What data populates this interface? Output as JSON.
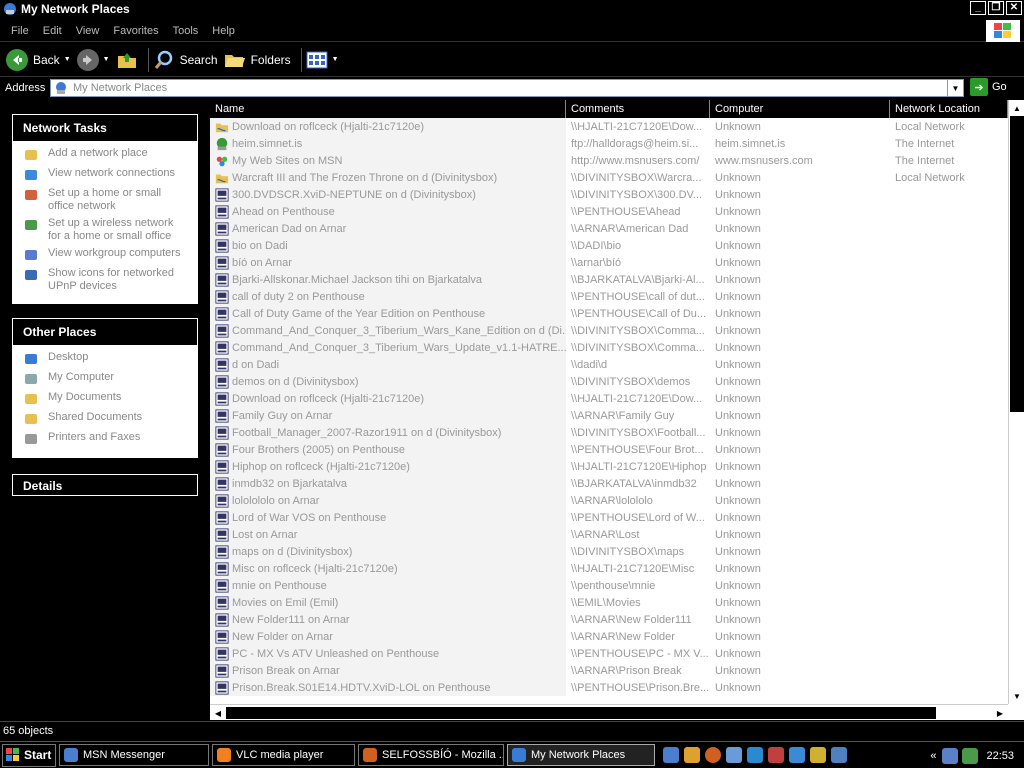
{
  "window": {
    "title": "My Network Places"
  },
  "menu": [
    "File",
    "Edit",
    "View",
    "Favorites",
    "Tools",
    "Help"
  ],
  "toolbar": {
    "back": "Back",
    "search": "Search",
    "folders": "Folders"
  },
  "address": {
    "label": "Address",
    "value": "My Network Places",
    "go": "Go"
  },
  "network_tasks": {
    "title": "Network Tasks",
    "items": [
      {
        "label": "Add a network place",
        "icon": "add-network-place-icon"
      },
      {
        "label": "View network connections",
        "icon": "network-connections-icon"
      },
      {
        "label": "Set up a home or small office network",
        "icon": "home-network-icon"
      },
      {
        "label": "Set up a wireless network for a home or small office",
        "icon": "wireless-network-icon"
      },
      {
        "label": "View workgroup computers",
        "icon": "workgroup-icon"
      },
      {
        "label": "Show icons for networked UPnP devices",
        "icon": "upnp-icon"
      }
    ]
  },
  "other_places": {
    "title": "Other Places",
    "items": [
      {
        "label": "Desktop",
        "icon": "desktop-icon"
      },
      {
        "label": "My Computer",
        "icon": "my-computer-icon"
      },
      {
        "label": "My Documents",
        "icon": "my-documents-icon"
      },
      {
        "label": "Shared Documents",
        "icon": "folder-icon"
      },
      {
        "label": "Printers and Faxes",
        "icon": "printer-icon"
      }
    ]
  },
  "details": {
    "title": "Details"
  },
  "columns": [
    "Name",
    "Comments",
    "Computer",
    "Network Location"
  ],
  "rows": [
    {
      "name": "Download on roflceck (Hjalti-21c7120e)",
      "comments": "\\\\HJALTI-21C7120E\\Dow...",
      "computer": "Unknown",
      "location": "Local Network",
      "icon": "share"
    },
    {
      "name": "heim.simnet.is",
      "comments": "ftp://halldorags@heim.si...",
      "computer": "heim.simnet.is",
      "location": "The Internet",
      "icon": "ftp"
    },
    {
      "name": "My Web Sites on MSN",
      "comments": "http://www.msnusers.com/",
      "computer": "www.msnusers.com",
      "location": "The Internet",
      "icon": "msn"
    },
    {
      "name": "Warcraft III and The Frozen Throne on d (Divinitysbox)",
      "comments": "\\\\DIVINITYSBOX\\Warcra...",
      "computer": "Unknown",
      "location": "Local Network",
      "icon": "share"
    },
    {
      "name": "300.DVDSCR.XviD-NEPTUNE on d (Divinitysbox)",
      "comments": "\\\\DIVINITYSBOX\\300.DV...",
      "computer": "Unknown",
      "location": "",
      "icon": "net"
    },
    {
      "name": "Ahead on Penthouse",
      "comments": "\\\\PENTHOUSE\\Ahead",
      "computer": "Unknown",
      "location": "",
      "icon": "net"
    },
    {
      "name": "American Dad on Arnar",
      "comments": "\\\\ARNAR\\American Dad",
      "computer": "Unknown",
      "location": "",
      "icon": "net"
    },
    {
      "name": "bio on Dadi",
      "comments": "\\\\DADI\\bio",
      "computer": "Unknown",
      "location": "",
      "icon": "net"
    },
    {
      "name": "bíó on Arnar",
      "comments": "\\\\arnar\\bíó",
      "computer": "Unknown",
      "location": "",
      "icon": "net"
    },
    {
      "name": "Bjarki-Allskonar.Michael Jackson tihi on Bjarkatalva",
      "comments": "\\\\BJARKATALVA\\Bjarki-Al...",
      "computer": "Unknown",
      "location": "",
      "icon": "net"
    },
    {
      "name": "call of duty 2 on Penthouse",
      "comments": "\\\\PENTHOUSE\\call of dut...",
      "computer": "Unknown",
      "location": "",
      "icon": "net"
    },
    {
      "name": "Call of Duty Game of the Year Edition on Penthouse",
      "comments": "\\\\PENTHOUSE\\Call of Du...",
      "computer": "Unknown",
      "location": "",
      "icon": "net"
    },
    {
      "name": "Command_And_Conquer_3_Tiberium_Wars_Kane_Edition on d (Di...",
      "comments": "\\\\DIVINITYSBOX\\Comma...",
      "computer": "Unknown",
      "location": "",
      "icon": "net"
    },
    {
      "name": "Command_And_Conquer_3_Tiberium_Wars_Update_v1.1-HATRE...",
      "comments": "\\\\DIVINITYSBOX\\Comma...",
      "computer": "Unknown",
      "location": "",
      "icon": "net"
    },
    {
      "name": "d on Dadi",
      "comments": "\\\\dadi\\d",
      "computer": "Unknown",
      "location": "",
      "icon": "net"
    },
    {
      "name": "demos on d (Divinitysbox)",
      "comments": "\\\\DIVINITYSBOX\\demos",
      "computer": "Unknown",
      "location": "",
      "icon": "net"
    },
    {
      "name": "Download on roflceck (Hjalti-21c7120e)",
      "comments": "\\\\HJALTI-21C7120E\\Dow...",
      "computer": "Unknown",
      "location": "",
      "icon": "net"
    },
    {
      "name": "Family Guy on Arnar",
      "comments": "\\\\ARNAR\\Family Guy",
      "computer": "Unknown",
      "location": "",
      "icon": "net"
    },
    {
      "name": "Football_Manager_2007-Razor1911 on d (Divinitysbox)",
      "comments": "\\\\DIVINITYSBOX\\Football...",
      "computer": "Unknown",
      "location": "",
      "icon": "net"
    },
    {
      "name": "Four Brothers (2005) on Penthouse",
      "comments": "\\\\PENTHOUSE\\Four Brot...",
      "computer": "Unknown",
      "location": "",
      "icon": "net"
    },
    {
      "name": "Hiphop on roflceck (Hjalti-21c7120e)",
      "comments": "\\\\HJALTI-21C7120E\\Hiphop",
      "computer": "Unknown",
      "location": "",
      "icon": "net"
    },
    {
      "name": "inmdb32 on Bjarkatalva",
      "comments": "\\\\BJARKATALVA\\inmdb32",
      "computer": "Unknown",
      "location": "",
      "icon": "net"
    },
    {
      "name": "lololololo on Arnar",
      "comments": "\\\\ARNAR\\lolololo",
      "computer": "Unknown",
      "location": "",
      "icon": "net"
    },
    {
      "name": "Lord of War VOS on Penthouse",
      "comments": "\\\\PENTHOUSE\\Lord of W...",
      "computer": "Unknown",
      "location": "",
      "icon": "net"
    },
    {
      "name": "Lost on Arnar",
      "comments": "\\\\ARNAR\\Lost",
      "computer": "Unknown",
      "location": "",
      "icon": "net"
    },
    {
      "name": "maps on d (Divinitysbox)",
      "comments": "\\\\DIVINITYSBOX\\maps",
      "computer": "Unknown",
      "location": "",
      "icon": "net"
    },
    {
      "name": "Misc on roflceck (Hjalti-21c7120e)",
      "comments": "\\\\HJALTI-21C7120E\\Misc",
      "computer": "Unknown",
      "location": "",
      "icon": "net"
    },
    {
      "name": "mnie on Penthouse",
      "comments": "\\\\penthouse\\mnie",
      "computer": "Unknown",
      "location": "",
      "icon": "net"
    },
    {
      "name": "Movies on Emil (Emil)",
      "comments": "\\\\EMIL\\Movies",
      "computer": "Unknown",
      "location": "",
      "icon": "net"
    },
    {
      "name": "New Folder111 on Arnar",
      "comments": "\\\\ARNAR\\New Folder111",
      "computer": "Unknown",
      "location": "",
      "icon": "net"
    },
    {
      "name": "New Folder on Arnar",
      "comments": "\\\\ARNAR\\New Folder",
      "computer": "Unknown",
      "location": "",
      "icon": "net"
    },
    {
      "name": "PC - MX Vs ATV Unleashed on Penthouse",
      "comments": "\\\\PENTHOUSE\\PC - MX V...",
      "computer": "Unknown",
      "location": "",
      "icon": "net"
    },
    {
      "name": "Prison Break on Arnar",
      "comments": "\\\\ARNAR\\Prison Break",
      "computer": "Unknown",
      "location": "",
      "icon": "net"
    },
    {
      "name": "Prison.Break.S01E14.HDTV.XviD-LOL on Penthouse",
      "comments": "\\\\PENTHOUSE\\Prison.Bre...",
      "computer": "Unknown",
      "location": "",
      "icon": "net"
    }
  ],
  "status": {
    "text": "65 objects"
  },
  "taskbar": {
    "start": "Start",
    "tasks": [
      {
        "label": "MSN Messenger",
        "icon": "msn-icon",
        "active": false
      },
      {
        "label": "VLC media player",
        "icon": "vlc-icon",
        "active": false
      },
      {
        "label": "SELFOSSBÍÓ - Mozilla ...",
        "icon": "firefox-icon",
        "active": false
      },
      {
        "label": "My Network Places",
        "icon": "network-places-icon",
        "active": true
      }
    ],
    "clock": "22:53"
  },
  "colors": {
    "background": "#000000",
    "list_bg": "#ffffff",
    "name_col_bg": "#f3f3f3",
    "text_dim": "#999999"
  }
}
